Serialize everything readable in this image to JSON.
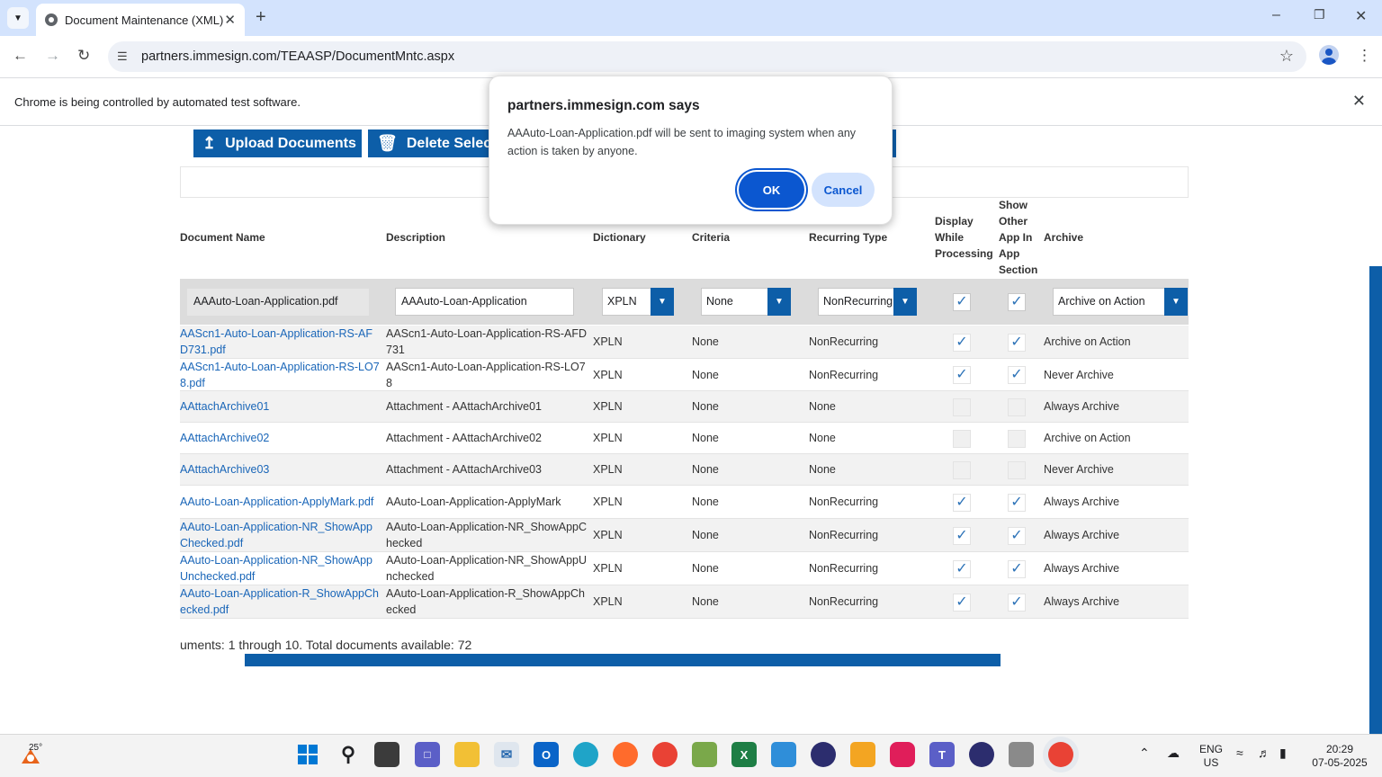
{
  "browser": {
    "tab_title": "Document Maintenance (XML)",
    "url": "partners.immesign.com/TEAASP/DocumentMntc.aspx",
    "infobar_text": "Chrome is being controlled by automated test software."
  },
  "toolbar": {
    "upload_label": "Upload Documents",
    "delete_label": "Delete Selected"
  },
  "table": {
    "headers": {
      "name": "Document Name",
      "description": "Description",
      "dictionary": "Dictionary",
      "criteria": "Criteria",
      "recurring": "Recurring Type",
      "display": "Display While Processing",
      "show_other": "Show Other App In App Section",
      "archive": "Archive"
    },
    "edit_row": {
      "name": "AAAuto-Loan-Application.pdf",
      "description": "AAAuto-Loan-Application",
      "dictionary": "XPLN",
      "criteria": "None",
      "recurring": "NonRecurring",
      "display": true,
      "show_other": true,
      "archive": "Archive on Action"
    },
    "rows": [
      {
        "name": "AAScn1-Auto-Loan-Application-RS-AFD731.pdf",
        "description": "AAScn1-Auto-Loan-Application-RS-AFD731",
        "dictionary": "XPLN",
        "criteria": "None",
        "recurring": "NonRecurring",
        "display": true,
        "show_other": true,
        "archive": "Archive on Action"
      },
      {
        "name": "AAScn1-Auto-Loan-Application-RS-LO78.pdf",
        "description": "AAScn1-Auto-Loan-Application-RS-LO78",
        "dictionary": "XPLN",
        "criteria": "None",
        "recurring": "NonRecurring",
        "display": true,
        "show_other": true,
        "archive": "Never Archive"
      },
      {
        "name": "AAttachArchive01",
        "description": "Attachment - AAttachArchive01",
        "dictionary": "XPLN",
        "criteria": "None",
        "recurring": "None",
        "display": false,
        "show_other": false,
        "archive": "Always Archive"
      },
      {
        "name": "AAttachArchive02",
        "description": "Attachment - AAttachArchive02",
        "dictionary": "XPLN",
        "criteria": "None",
        "recurring": "None",
        "display": false,
        "show_other": false,
        "archive": "Archive on Action"
      },
      {
        "name": "AAttachArchive03",
        "description": "Attachment - AAttachArchive03",
        "dictionary": "XPLN",
        "criteria": "None",
        "recurring": "None",
        "display": false,
        "show_other": false,
        "archive": "Never Archive"
      },
      {
        "name": "AAuto-Loan-Application-ApplyMark.pdf",
        "description": "AAuto-Loan-Application-ApplyMark",
        "dictionary": "XPLN",
        "criteria": "None",
        "recurring": "NonRecurring",
        "display": true,
        "show_other": true,
        "archive": "Always Archive"
      },
      {
        "name": "AAuto-Loan-Application-NR_ShowAppChecked.pdf",
        "description": "AAuto-Loan-Application-NR_ShowAppChecked",
        "dictionary": "XPLN",
        "criteria": "None",
        "recurring": "NonRecurring",
        "display": true,
        "show_other": true,
        "archive": "Always Archive"
      },
      {
        "name": "AAuto-Loan-Application-NR_ShowAppUnchecked.pdf",
        "description": "AAuto-Loan-Application-NR_ShowAppUnchecked",
        "dictionary": "XPLN",
        "criteria": "None",
        "recurring": "NonRecurring",
        "display": true,
        "show_other": true,
        "archive": "Always Archive"
      },
      {
        "name": "AAuto-Loan-Application-R_ShowAppChecked.pdf",
        "description": "AAuto-Loan-Application-R_ShowAppChecked",
        "dictionary": "XPLN",
        "criteria": "None",
        "recurring": "NonRecurring",
        "display": true,
        "show_other": true,
        "archive": "Always Archive"
      }
    ],
    "footer": "uments: 1 through 10. Total documents available: 72"
  },
  "dialog": {
    "title": "partners.immesign.com says",
    "message": "AAAuto-Loan-Application.pdf will be sent to imaging system when any action is taken by anyone.",
    "ok_label": "OK",
    "cancel_label": "Cancel"
  },
  "taskbar": {
    "temperature": "25°",
    "lang": "ENG",
    "region": "US",
    "time": "20:29",
    "date": "07-05-2025"
  },
  "colors": {
    "accent": "#0d5ea8",
    "link": "#1a66b8",
    "dialog_ok": "#0b57d0"
  }
}
